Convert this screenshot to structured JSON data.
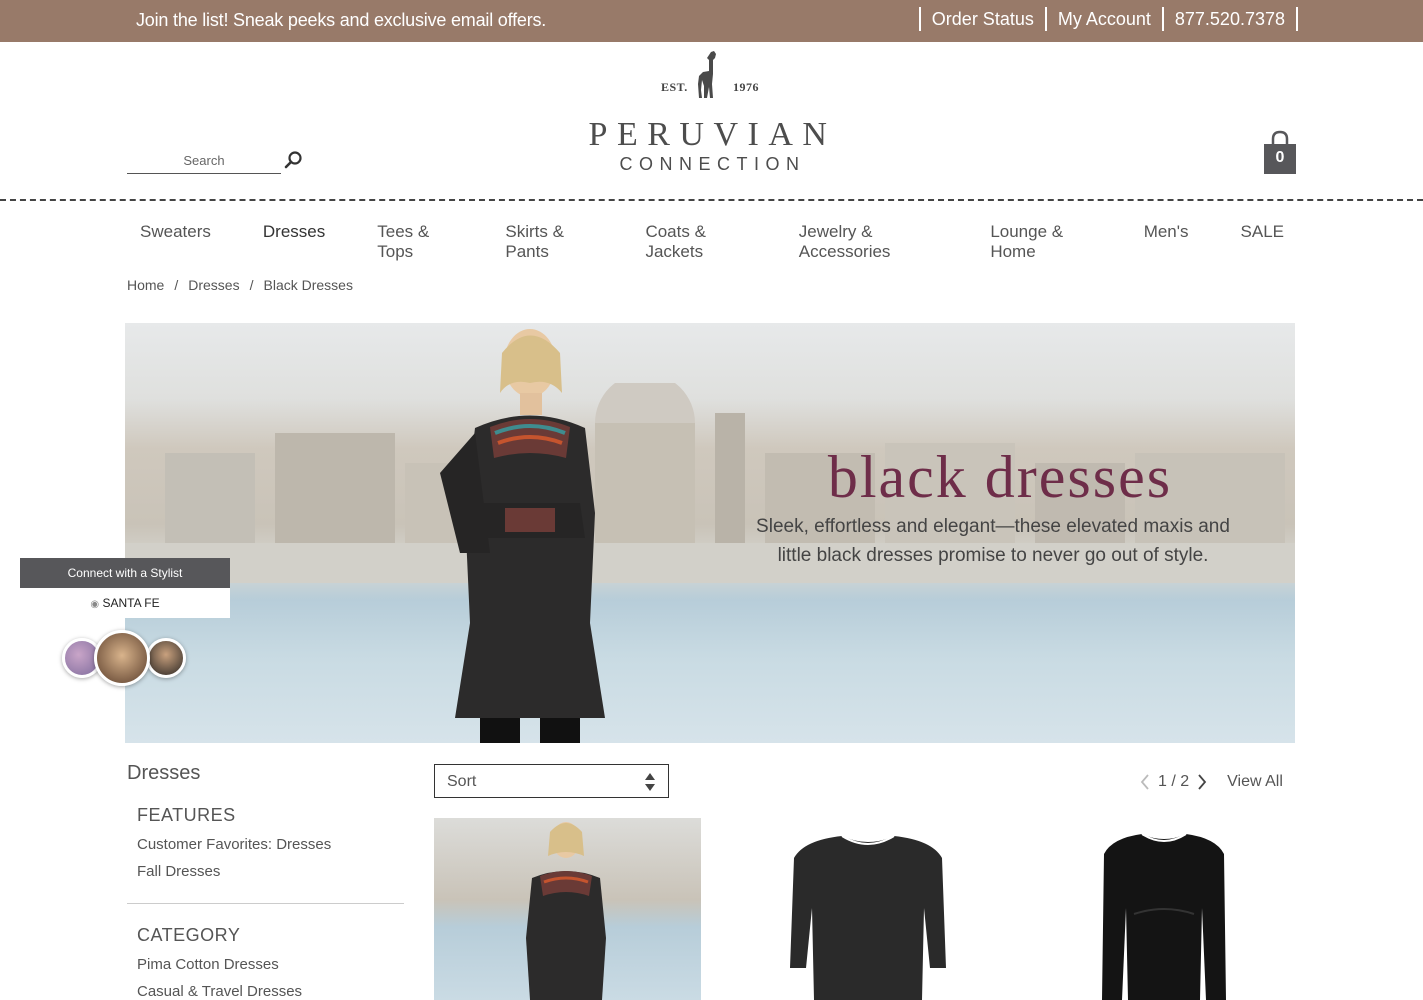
{
  "promo_bar": {
    "text": "Join the list! Sneak peeks and exclusive email offers.",
    "links": [
      "Order Status",
      "My Account",
      "877.520.7378"
    ],
    "background": "#987a69"
  },
  "search": {
    "placeholder": "Search",
    "icon": "search-icon"
  },
  "logo": {
    "est_left": "EST.",
    "est_right": "1976",
    "line1": "PERUVIAN",
    "line2": "CONNECTION"
  },
  "cart": {
    "count": "0",
    "icon": "shopping-bag-icon"
  },
  "nav": [
    "Sweaters",
    "Dresses",
    "Tees & Tops",
    "Skirts & Pants",
    "Coats & Jackets",
    "Jewelry & Accessories",
    "Lounge & Home",
    "Men's",
    "SALE"
  ],
  "nav_active": "Dresses",
  "breadcrumb": [
    "Home",
    "Dresses",
    "Black Dresses"
  ],
  "hero": {
    "title": "black dresses",
    "copy_line1": "Sleek, effortless and elegant—these elevated maxis and",
    "copy_line2": "little black dresses promise to never go out of style.",
    "title_color": "#6e2d49"
  },
  "stylist": {
    "header": "Connect with a Stylist",
    "location": "SANTA FE"
  },
  "sidebar": {
    "title": "Dresses",
    "features_heading": "FEATURES",
    "features": [
      "Customer Favorites: Dresses",
      "Fall Dresses"
    ],
    "category_heading": "CATEGORY",
    "categories": [
      "Pima Cotton Dresses",
      "Casual & Travel Dresses"
    ]
  },
  "toolbar": {
    "sort_label": "Sort",
    "page": "1 / 2",
    "view_all": "View All"
  }
}
